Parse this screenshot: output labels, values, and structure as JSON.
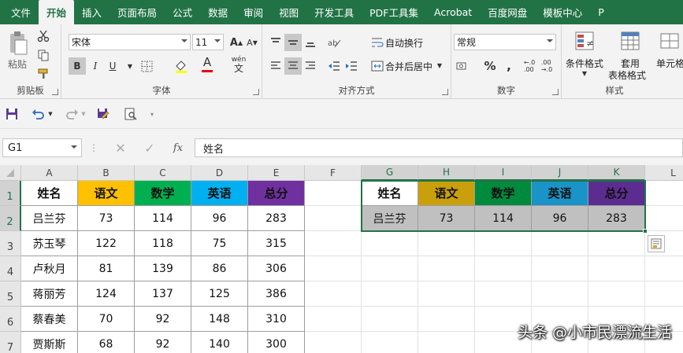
{
  "colors": {
    "excel_green": "#217346",
    "yuwen": "#ffc000",
    "shuxue": "#00b050",
    "yingyu": "#00b0f0",
    "zongfen": "#7030a0",
    "yuwen_copy": "#c9a00c",
    "shuxue_copy": "#008a3e",
    "yingyu_copy": "#1a93c8",
    "zongfen_copy": "#5c2d91",
    "copy_data_bg": "#c0c0c0"
  },
  "tabs": [
    "文件",
    "开始",
    "插入",
    "页面布局",
    "公式",
    "数据",
    "审阅",
    "视图",
    "开发工具",
    "PDF工具集",
    "Acrobat",
    "百度网盘",
    "模板中心",
    "P"
  ],
  "ribbon": {
    "clipboard": {
      "label": "剪贴板",
      "paste": "粘贴"
    },
    "font": {
      "label": "字体",
      "name": "宋体",
      "size": "11",
      "bold": "B",
      "italic": "I",
      "underline": "U",
      "grow": "A",
      "shrink": "A",
      "font_color": "A",
      "wen": "wén"
    },
    "align": {
      "label": "对齐方式",
      "wrap": "自动换行",
      "merge": "合并后居中"
    },
    "number": {
      "label": "数字",
      "format": "常规",
      "percent": "%",
      "comma": ","
    },
    "styles": {
      "label": "样式",
      "cond_format": "条件格式",
      "table_format_1": "套用",
      "table_format_2": "表格格式",
      "cell_style": "单元格"
    }
  },
  "formula_bar": {
    "name_box": "G1",
    "fx": "fx",
    "value": "姓名"
  },
  "columns": [
    "A",
    "B",
    "C",
    "D",
    "E",
    "F",
    "G",
    "H",
    "I",
    "J",
    "K",
    "L"
  ],
  "rows": [
    "1",
    "2",
    "3",
    "4",
    "5",
    "6",
    "7"
  ],
  "table": {
    "headers": [
      "姓名",
      "语文",
      "数学",
      "英语",
      "总分"
    ],
    "data": [
      [
        "吕兰芬",
        "73",
        "114",
        "96",
        "283"
      ],
      [
        "苏玉琴",
        "122",
        "118",
        "75",
        "315"
      ],
      [
        "卢秋月",
        "81",
        "139",
        "86",
        "306"
      ],
      [
        "蒋丽芳",
        "124",
        "137",
        "125",
        "386"
      ],
      [
        "蔡春美",
        "70",
        "92",
        "148",
        "310"
      ],
      [
        "贾斯斯",
        "68",
        "92",
        "140",
        "300"
      ]
    ]
  },
  "copy_table": {
    "headers": [
      "姓名",
      "语文",
      "数学",
      "英语",
      "总分"
    ],
    "data": [
      "吕兰芬",
      "73",
      "114",
      "96",
      "283"
    ]
  },
  "watermark": "头条 @小市民漂流生活"
}
